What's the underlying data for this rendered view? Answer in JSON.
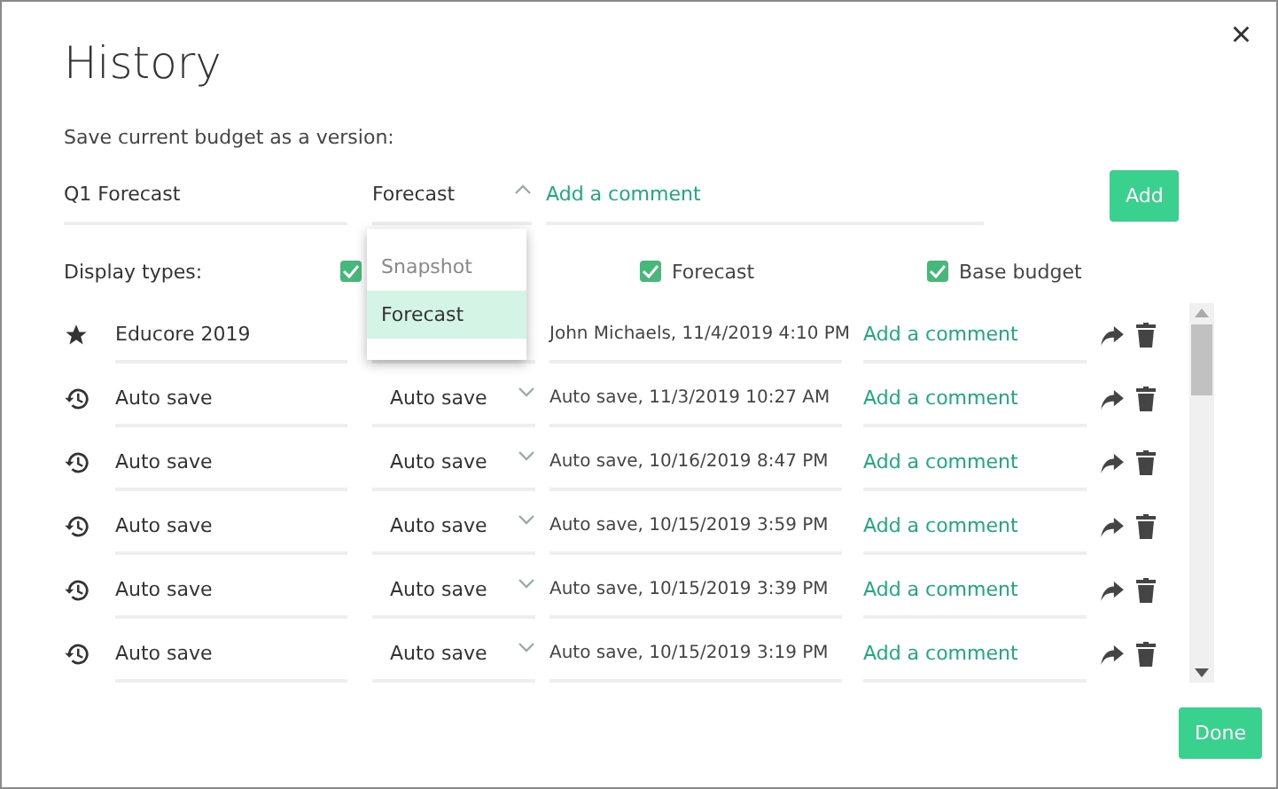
{
  "window": {
    "title": "History",
    "close": "×"
  },
  "save_version": {
    "label": "Save current budget as a version:",
    "name": "Q1 Forecast",
    "type": "Forecast",
    "comment_placeholder": "Add a comment",
    "add_button": "Add",
    "dropdown": {
      "expanded": true,
      "options": [
        {
          "label": "Snapshot",
          "selected": false
        },
        {
          "label": "Forecast",
          "selected": true
        }
      ]
    }
  },
  "display_types": {
    "label": "Display types:",
    "items": [
      {
        "checked": true
      },
      {
        "label": "Forecast",
        "checked": true
      },
      {
        "label": "Base budget",
        "checked": true
      }
    ]
  },
  "versions": [
    {
      "kind": "starred",
      "name": "Educore 2019",
      "description": "John Michaels, 11/4/2019 4:10 PM",
      "comment": "Add a comment"
    },
    {
      "kind": "autosave",
      "name": "Auto save",
      "type": "Auto save",
      "description": "Auto save, 11/3/2019 10:27 AM",
      "comment": "Add a comment"
    },
    {
      "kind": "autosave",
      "name": "Auto save",
      "type": "Auto save",
      "description": "Auto save, 10/16/2019 8:47 PM",
      "comment": "Add a comment"
    },
    {
      "kind": "autosave",
      "name": "Auto save",
      "type": "Auto save",
      "description": "Auto save, 10/15/2019 3:59 PM",
      "comment": "Add a comment"
    },
    {
      "kind": "autosave",
      "name": "Auto save",
      "type": "Auto save",
      "description": "Auto save, 10/15/2019 3:39 PM",
      "comment": "Add a comment"
    },
    {
      "kind": "autosave",
      "name": "Auto save",
      "type": "Auto save",
      "description": "Auto save, 10/15/2019 3:19 PM",
      "comment": "Add a comment"
    }
  ],
  "done_button": "Done"
}
